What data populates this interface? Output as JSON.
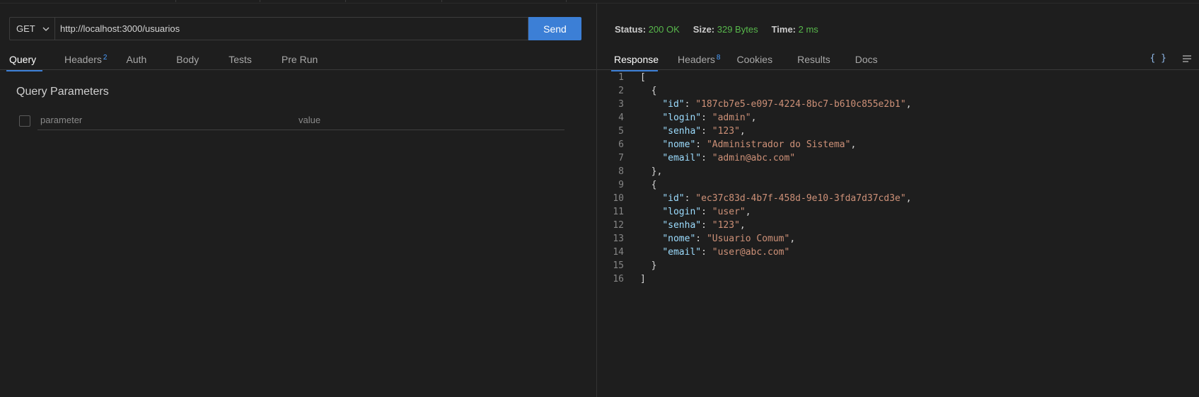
{
  "request": {
    "method": "GET",
    "url": "http://localhost:3000/usuarios",
    "send_label": "Send",
    "tabs": [
      {
        "label": "Query",
        "badge": ""
      },
      {
        "label": "Headers",
        "badge": "2"
      },
      {
        "label": "Auth",
        "badge": ""
      },
      {
        "label": "Body",
        "badge": ""
      },
      {
        "label": "Tests",
        "badge": ""
      },
      {
        "label": "Pre Run",
        "badge": ""
      }
    ],
    "query_title": "Query Parameters",
    "param_placeholder": "parameter",
    "value_placeholder": "value"
  },
  "response": {
    "status_label": "Status:",
    "status_value": "200 OK",
    "size_label": "Size:",
    "size_value": "329 Bytes",
    "time_label": "Time:",
    "time_value": "2 ms",
    "tabs": [
      {
        "label": "Response",
        "badge": ""
      },
      {
        "label": "Headers",
        "badge": "8"
      },
      {
        "label": "Cookies",
        "badge": ""
      },
      {
        "label": "Results",
        "badge": ""
      },
      {
        "label": "Docs",
        "badge": ""
      }
    ],
    "icons": [
      "braces-icon",
      "wrap-lines-icon"
    ],
    "braces_glyph": "{ }",
    "body_lines": [
      "[",
      "  {",
      "    \"id\": \"187cb7e5-e097-4224-8bc7-b610c855e2b1\",",
      "    \"login\": \"admin\",",
      "    \"senha\": \"123\",",
      "    \"nome\": \"Administrador do Sistema\",",
      "    \"email\": \"admin@abc.com\"",
      "  },",
      "  {",
      "    \"id\": \"ec37c83d-4b7f-458d-9e10-3fda7d37cd3e\",",
      "    \"login\": \"user\",",
      "    \"senha\": \"123\",",
      "    \"nome\": \"Usuario Comum\",",
      "    \"email\": \"user@abc.com\"",
      "  }",
      "]"
    ]
  },
  "colors": {
    "accent": "#3c7fd6",
    "status_ok": "#58b84c",
    "json_key": "#9cdcfe",
    "json_string": "#ce9178"
  }
}
